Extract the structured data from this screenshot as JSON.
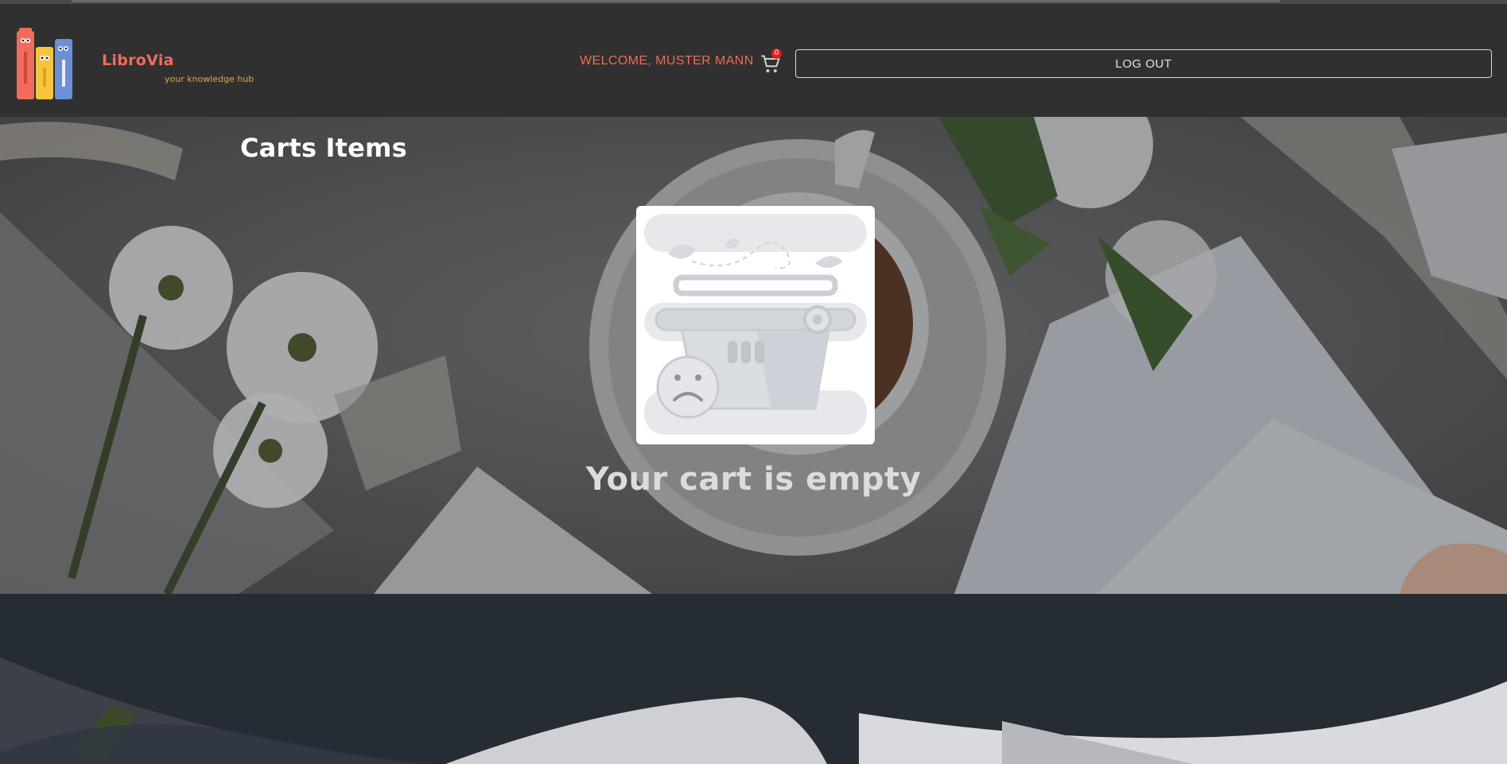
{
  "header": {
    "brand_name": "LibroVia",
    "tagline": "your knowledge hub",
    "welcome_text": "WELCOME, MUSTER MANN",
    "cart_count": "0",
    "logout_label": "LOG OUT"
  },
  "main": {
    "title": "Carts Items",
    "empty_message": "Your cart is empty"
  },
  "icons": {
    "logo": "books-logo-icon",
    "cart": "shopping-cart-icon",
    "empty_illustration": "empty-basket-sad-face-icon"
  },
  "colors": {
    "header_bg": "#303030",
    "brand": "#f26b5b",
    "tagline": "#e8a43c",
    "welcome": "#ef6b56",
    "badge": "#e11d1d",
    "page_bg": "#262c34"
  }
}
